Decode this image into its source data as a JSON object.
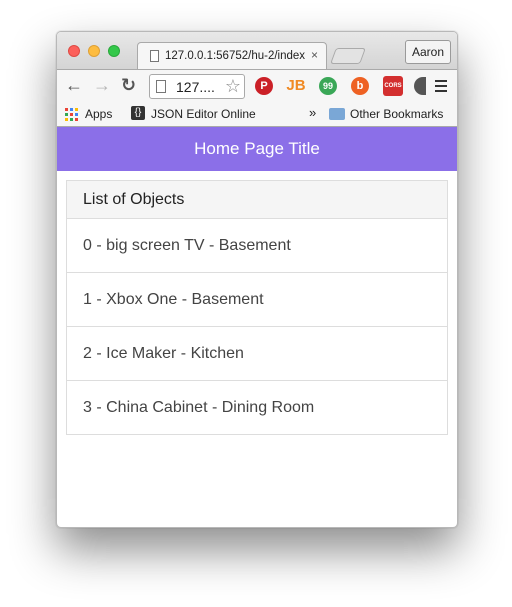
{
  "browser": {
    "tab_title": "127.0.0.1:56752/hu-2/index",
    "tab_close": "×",
    "profile_name": "Aaron",
    "address": "127....",
    "nav": {
      "back": "←",
      "forward": "→",
      "reload": "↻"
    },
    "bookmarks": {
      "apps": "Apps",
      "json_editor": "JSON Editor Online",
      "overflow": "»",
      "other": "Other Bookmarks"
    },
    "extensions": [
      {
        "name": "pinterest",
        "label": "P",
        "color": "#cb2027"
      },
      {
        "name": "jetbrains",
        "label": "JB",
        "color": "#f08a24"
      },
      {
        "name": "hangouts",
        "label": "99",
        "color": "#3aa757"
      },
      {
        "name": "bitly",
        "label": "b",
        "color": "#ee6123"
      },
      {
        "name": "cors",
        "label": "CORS",
        "color": "#d32f2f"
      }
    ]
  },
  "page": {
    "title": "Home Page Title",
    "list_heading": "List of Objects",
    "items": [
      "0 - big screen TV - Basement",
      "1 - Xbox One - Basement",
      "2 - Ice Maker - Kitchen",
      "3 - China Cabinet - Dining Room"
    ],
    "header_color": "#8b6fe8"
  }
}
